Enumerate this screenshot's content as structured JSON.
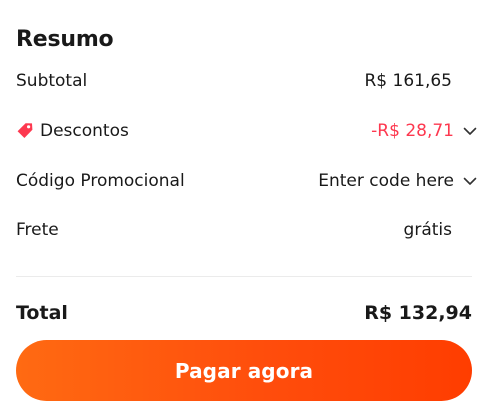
{
  "summary": {
    "title": "Resumo",
    "subtotal": {
      "label": "Subtotal",
      "value": "R$ 161,65"
    },
    "discount": {
      "label": "Descontos",
      "value": "-R$ 28,71",
      "icon": "tag-icon",
      "color": "#fd384f"
    },
    "promo": {
      "label": "Código Promocional",
      "value": "Enter code here"
    },
    "shipping": {
      "label": "Frete",
      "value": "grátis"
    },
    "total": {
      "label": "Total",
      "value": "R$ 132,94"
    },
    "pay_button": {
      "label": "Pagar agora",
      "color_start": "#ff6a12",
      "color_end": "#ff3d00"
    }
  }
}
